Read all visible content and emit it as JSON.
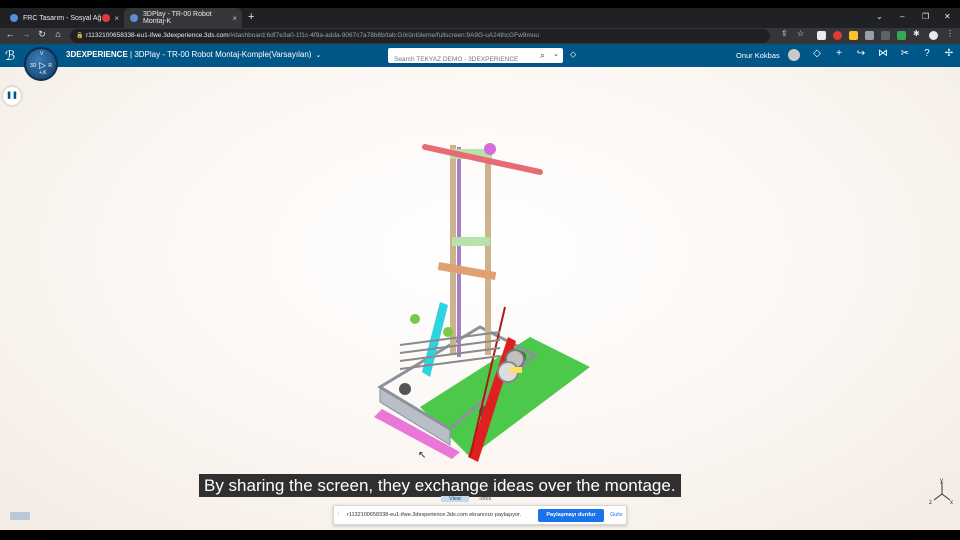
{
  "browser": {
    "tabs": [
      {
        "label": "FRC Tasarım - Sosyal Ağ",
        "active": false
      },
      {
        "label": "",
        "active": false
      },
      {
        "label": "3DPlay - TR-00 Robot Montaj-K",
        "active": true
      }
    ],
    "close_glyph": "×",
    "new_tab_glyph": "+",
    "url_host": "r1132100658338-eu1-ifwe.3dexperience.3ds.com",
    "url_path": "/#dashboard:6df7e3a0-1f1c-4f9a-adda-9067c7a78b6b/tab:Görüntüleme/fullscreen:9A9G-uA24thcGFw9muu"
  },
  "app": {
    "brand": "3DEXPERIENCE",
    "separator": " | ",
    "title": "3DPlay - TR-00 Robot Montaj-Komple(Varsayılan)",
    "search_placeholder": "Search TEKYAZ DEMO - 3DEXPERIENCE",
    "user_name": "Onur Kokbas",
    "compass": {
      "top": "V",
      "left": "3D",
      "right": "R",
      "bottom": "+,K"
    }
  },
  "viewer": {
    "subtitle": "By sharing the screen, they exchange ideas over the montage.",
    "tabs": [
      {
        "label": "View",
        "active": true
      },
      {
        "label": "Tools",
        "active": false
      }
    ],
    "axis_labels": {
      "y": "y",
      "z": "z",
      "x": "x"
    }
  },
  "share_bar": {
    "message": "r1132100658338-eu1-ifwe.3dexperience.3ds.com ekranınızı paylaşıyor.",
    "stop_label": "Paylaşmayı durdur",
    "hide_label": "Gizle"
  },
  "colors": {
    "appbar": "#005686",
    "browser_dark": "#202124",
    "browser_mid": "#35363a",
    "primary_button": "#1a73e8"
  }
}
